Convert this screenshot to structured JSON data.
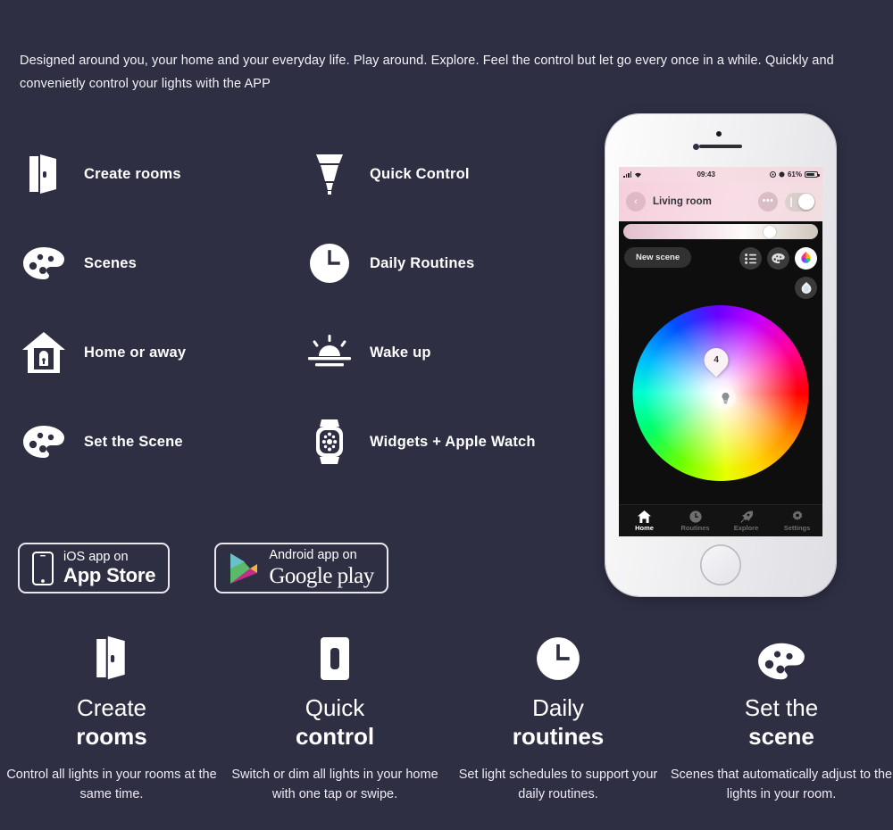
{
  "intro": {
    "paragraph": "Designed around you, your home and your everyday life. Play around. Explore. Feel the control but let go every once in a while. Quickly and convenietly control your lights with the  APP"
  },
  "colors": {
    "background": "#2f2f44",
    "text": "#ffffff",
    "phone_body": "#f1f1f3",
    "screen": "#0e0e0e",
    "header_pink": "#f6cfdd",
    "tab_active": "#ffffff",
    "tab_inactive": "#6e6e6e"
  },
  "features": [
    {
      "icon": "open-door-icon",
      "label": "Create rooms"
    },
    {
      "icon": "light-bulb-icon",
      "label": "Quick Control"
    },
    {
      "icon": "palette-icon",
      "label": "Scenes"
    },
    {
      "icon": "clock-icon",
      "label": "Daily Routines"
    },
    {
      "icon": "house-lock-icon",
      "label": "Home or away"
    },
    {
      "icon": "sunrise-icon",
      "label": "Wake up"
    },
    {
      "icon": "palette-icon",
      "label": "Set the Scene"
    },
    {
      "icon": "smart-watch-icon",
      "label": "Widgets + Apple Watch"
    }
  ],
  "badges": [
    {
      "icon": "iphone-icon",
      "small": "iOS app on",
      "big": "App Store",
      "style": "bold"
    },
    {
      "icon": "google-play-icon",
      "small": "Android app on",
      "big": "Google play",
      "style": "serif"
    }
  ],
  "phone": {
    "status_bar": {
      "time": "09:43",
      "battery": "61%"
    },
    "header": {
      "back": "‹",
      "room": "Living room",
      "more": "•••",
      "toggle_state": "on"
    },
    "brightness": {
      "value": "72%"
    },
    "scene_pill": "New scene",
    "tools": [
      {
        "icon": "list-icon",
        "active": false
      },
      {
        "icon": "palette-icon",
        "active": false
      },
      {
        "icon": "color-wheel-icon",
        "active": true
      },
      {
        "icon": "bulb-drop-icon",
        "active": false
      }
    ],
    "color_wheel": {
      "pin_label": "4",
      "center_icon": "bulb-icon"
    },
    "tabs": [
      {
        "icon": "home-icon",
        "label": "Home",
        "active": true
      },
      {
        "icon": "clock-icon",
        "label": "Routines",
        "active": false
      },
      {
        "icon": "rocket-icon",
        "label": "Explore",
        "active": false
      },
      {
        "icon": "gear-icon",
        "label": "Settings",
        "active": false
      }
    ]
  },
  "bottom_cards": [
    {
      "icon": "open-door-icon",
      "title_line1": "Create",
      "title_line2": "rooms",
      "desc": "Control all lights in your rooms at the same time."
    },
    {
      "icon": "light-switch-icon",
      "title_line1": "Quick",
      "title_line2": "control",
      "desc": "Switch or dim all lights in your home with one tap or swipe."
    },
    {
      "icon": "clock-icon",
      "title_line1": "Daily",
      "title_line2": "routines",
      "desc": "Set light schedules to support your daily routines."
    },
    {
      "icon": "palette-icon",
      "title_line1": "Set the",
      "title_line2": "scene",
      "desc": "Scenes that automatically adjust to the lights in your room."
    }
  ]
}
